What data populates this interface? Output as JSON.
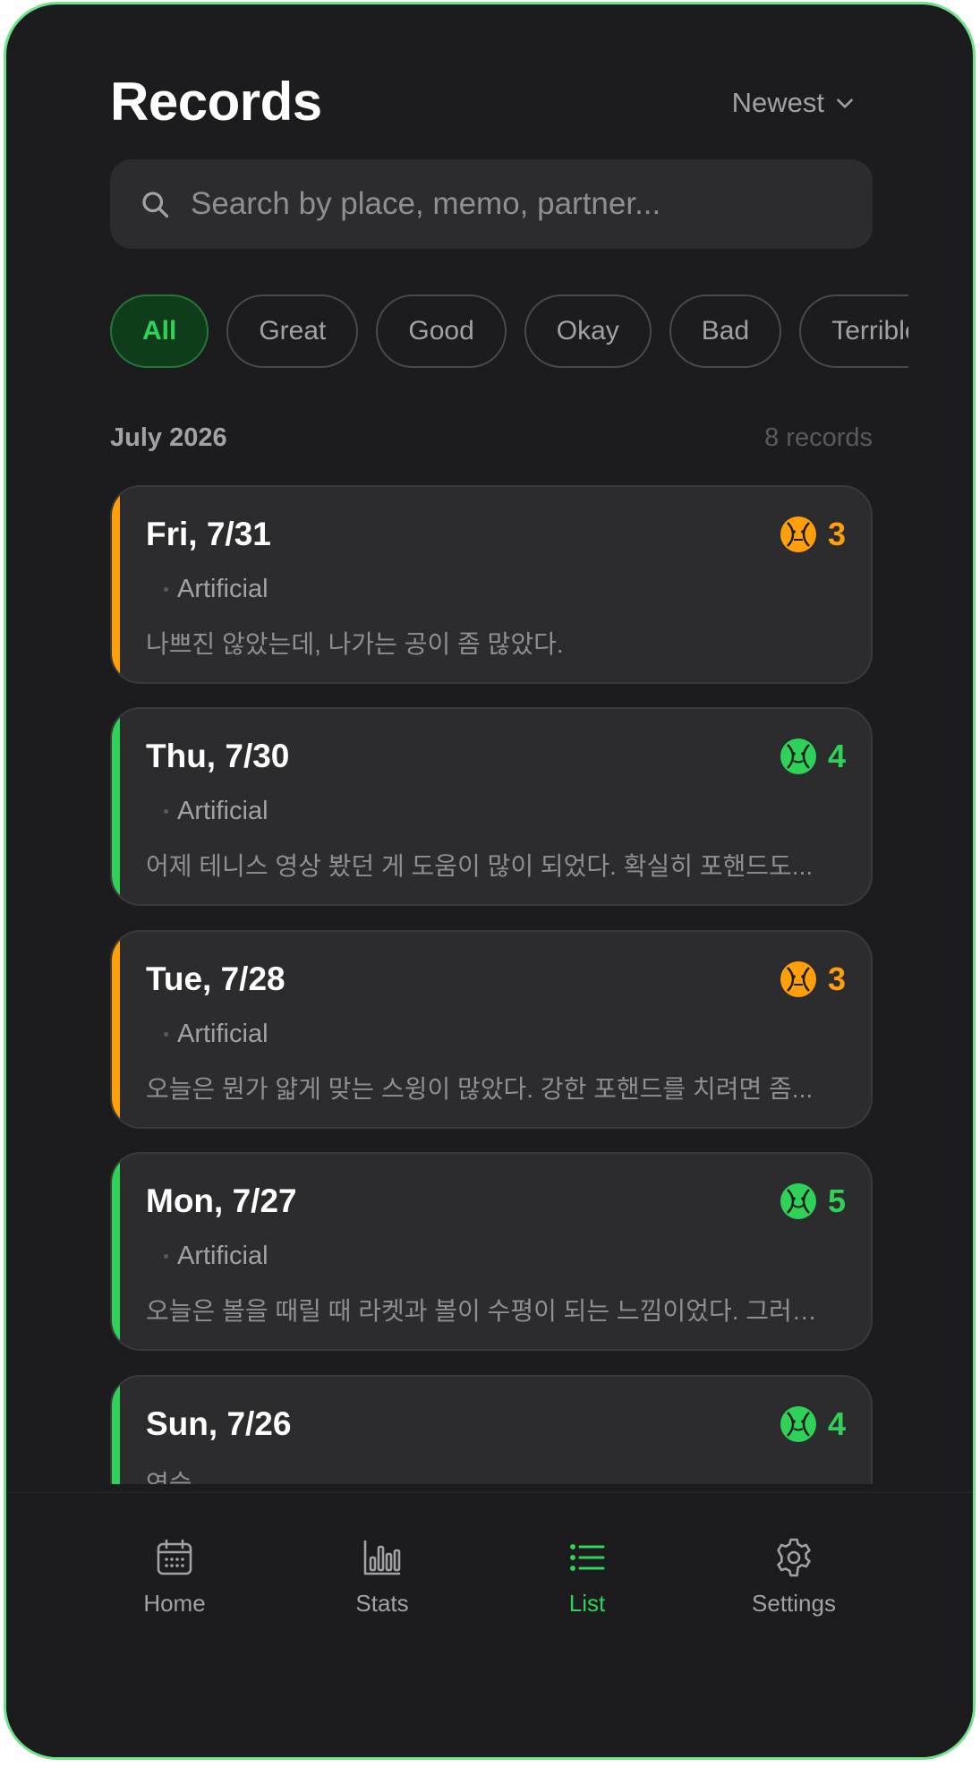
{
  "header": {
    "title": "Records",
    "sort_label": "Newest"
  },
  "search": {
    "placeholder": "Search by place, memo, partner..."
  },
  "filters": [
    {
      "label": "All",
      "active": true
    },
    {
      "label": "Great",
      "active": false
    },
    {
      "label": "Good",
      "active": false
    },
    {
      "label": "Okay",
      "active": false
    },
    {
      "label": "Bad",
      "active": false
    },
    {
      "label": "Terrible",
      "active": false
    }
  ],
  "month": {
    "label": "July 2026",
    "count": "8 records"
  },
  "records": [
    {
      "date": "Fri, 7/31",
      "rating": "3",
      "color": "#ff9f0a",
      "surface": "Artificial",
      "memo": "나쁘진 않았는데, 나가는 공이 좀 많았다."
    },
    {
      "date": "Thu, 7/30",
      "rating": "4",
      "color": "#30d158",
      "surface": "Artificial",
      "memo": "어제 테니스 영상 봤던 게 도움이 많이 되었다. 확실히 포핸드도..."
    },
    {
      "date": "Tue, 7/28",
      "rating": "3",
      "color": "#ff9f0a",
      "surface": "Artificial",
      "memo": "오늘은 뭔가 얇게 맞는 스윙이 많았다. 강한 포핸드를 치려면 좀..."
    },
    {
      "date": "Mon, 7/27",
      "rating": "5",
      "color": "#30d158",
      "surface": "Artificial",
      "memo": "오늘은 볼을 때릴 때 라켓과 볼이 수평이 되는 느낌이었다. 그러다가..."
    },
    {
      "date": "Sun, 7/26",
      "rating": "4",
      "color": "#30d158",
      "surface": "",
      "memo": "연습"
    }
  ],
  "tabs": [
    {
      "label": "Home",
      "icon": "calendar-icon",
      "active": false
    },
    {
      "label": "Stats",
      "icon": "bar-chart-icon",
      "active": false
    },
    {
      "label": "List",
      "icon": "list-icon",
      "active": true
    },
    {
      "label": "Settings",
      "icon": "gear-icon",
      "active": false
    }
  ]
}
